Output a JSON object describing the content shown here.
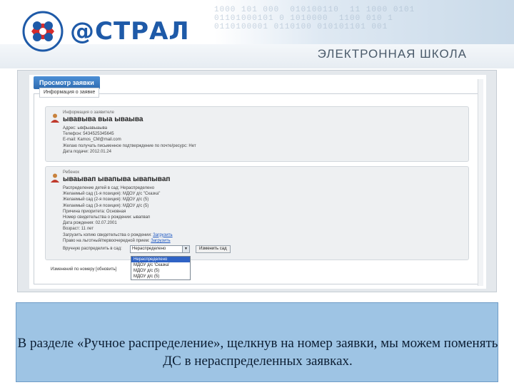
{
  "header": {
    "logo_text": "@СТРАЛ",
    "school_title": "ЭЛЕКТРОННАЯ ШКОЛА",
    "binary_decoration": "1000 101 000  010100110  11 1000 0101\n01101000101 0 1010000  1100 010 1\n0110100001 0110100 010101101 001",
    "colors": {
      "brand_blue": "#1e5aa8",
      "accent_red": "#d62b2b"
    }
  },
  "screenshot": {
    "view_button": "Просмотр заявки",
    "form_tab": "Информация о заявке",
    "applicant": {
      "role": "Информация о заявителе",
      "name": "ывавыва выа ываыва",
      "rows": [
        "Адрес: ывфыавыаыва",
        "Телефон: 5434525345645",
        "E-mail: Kamos_CM@mail.com",
        "Желаю получать письменное подтверждение по почте/ресурс: Нет",
        "Дата подачи: 2012.01.24"
      ]
    },
    "child": {
      "role": "Ребенок",
      "name": "ываывап ывапыва ывапывап",
      "rows": [
        "Распределение детей в сад: Нераспределено",
        "Желаемый сад (1-я позиция): МДОУ д/с \"Сказка\"",
        "Желаемый сад (2-я позиция): МДОУ д/с (5)",
        "Желаемый сад (3-я позиция): МДОУ д/с (5)",
        "Причина приоритета: Основная",
        "Номер свидетельства о рождении: ывапвап",
        "Дата рождения: 02.07.2001",
        "Возраст: 11 лет"
      ],
      "link_rows": [
        {
          "label": "Загрузить копию свидетельства о рождении:",
          "link": "Загрузить"
        },
        {
          "label": "Право на льготный/первоочередной прием:",
          "link": "Загрузить"
        }
      ]
    },
    "assign_label": "Вручную распределить в сад:",
    "select_value": "Нераспределено",
    "change_button": "Изменить сад",
    "dropdown_options": [
      "Нераспределено",
      "МДОУ д/с 'Сказка'",
      "МДОУ д/с (5)",
      "МДОУ д/с (5)"
    ],
    "footer_text": "Изменений по номеру [обновить]"
  },
  "caption": {
    "text": "В разделе «Ручное распределение», щелкнув на номер заявки, мы можем поменять ДС в нераспределенных заявках."
  }
}
